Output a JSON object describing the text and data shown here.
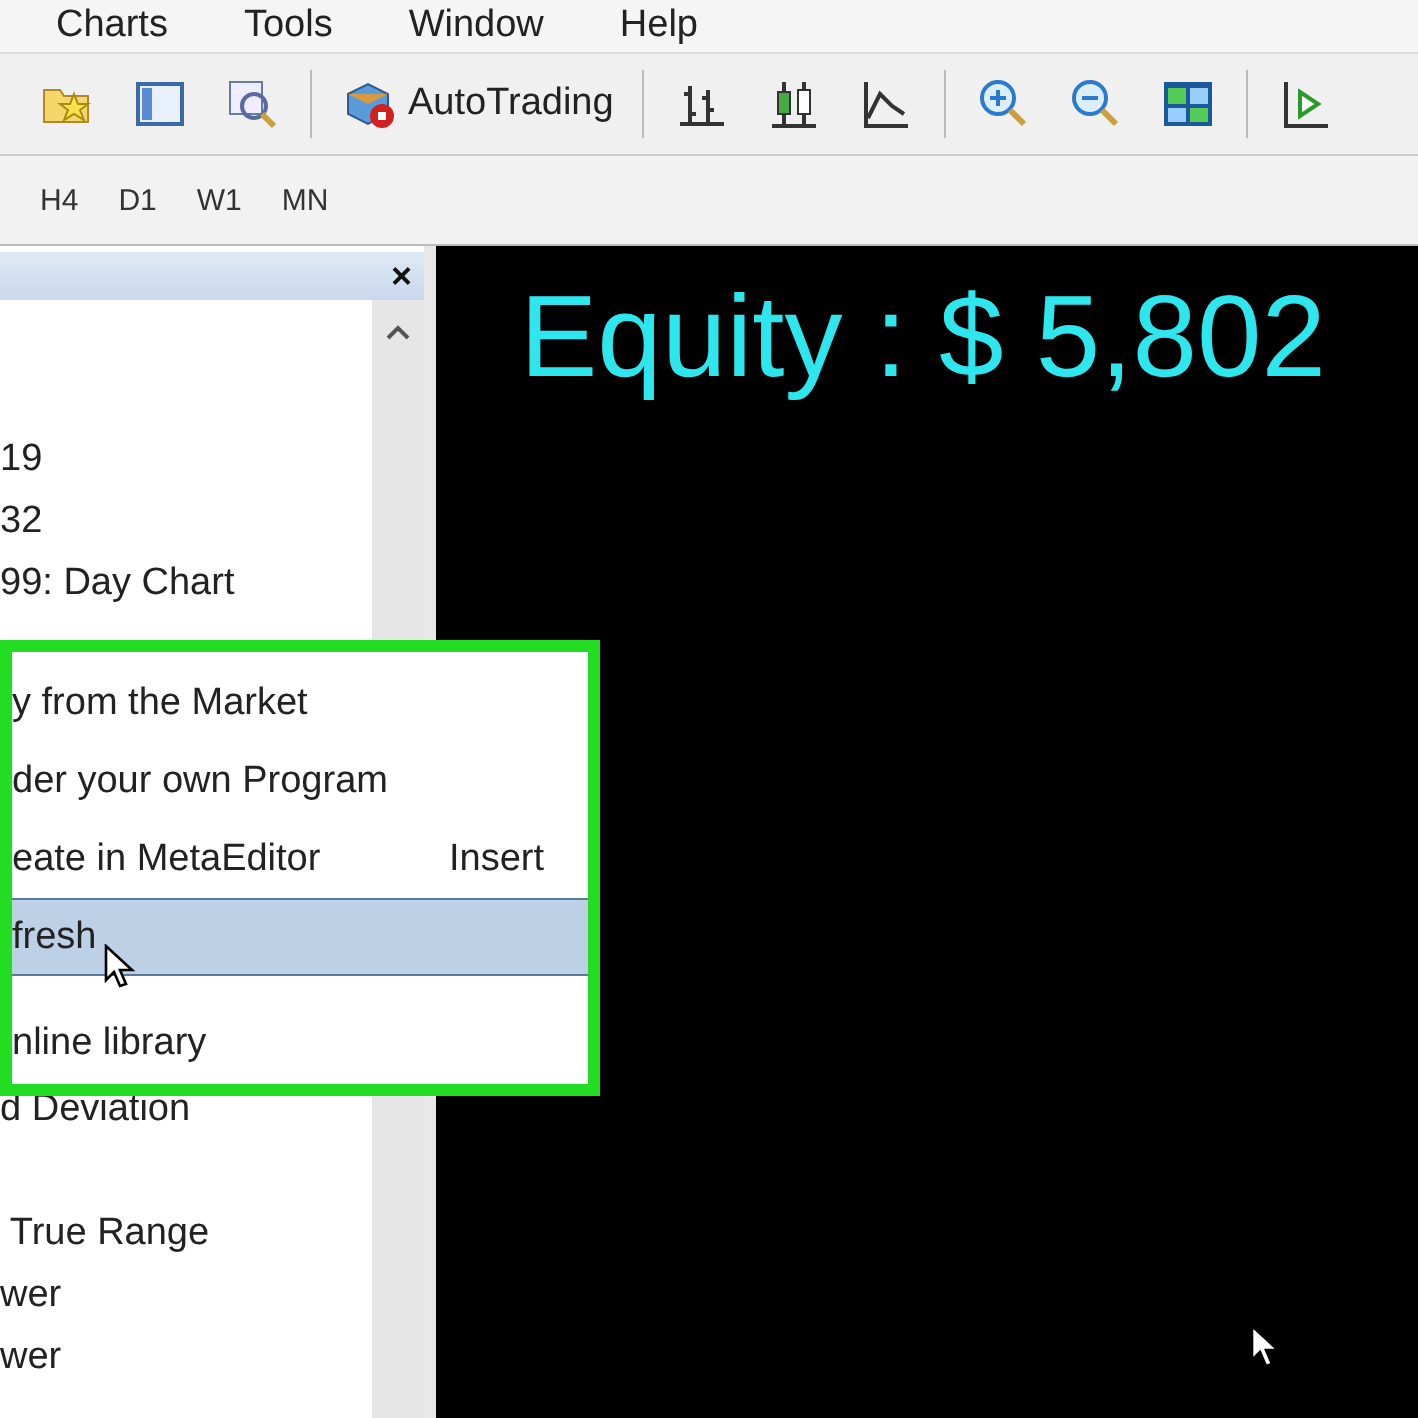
{
  "menu_bar": {
    "items": [
      "Charts",
      "Tools",
      "Window",
      "Help"
    ]
  },
  "toolbar": {
    "items": [
      {
        "kind": "starfolder"
      },
      {
        "kind": "panel"
      },
      {
        "kind": "magnifier"
      },
      {
        "kind": "autotrading",
        "label": "AutoTrading"
      },
      {
        "kind": "bars"
      },
      {
        "kind": "candles"
      },
      {
        "kind": "line"
      },
      {
        "kind": "zoomin"
      },
      {
        "kind": "zoomout"
      },
      {
        "kind": "tile"
      },
      {
        "kind": "shift"
      }
    ]
  },
  "timeframes": [
    "H4",
    "D1",
    "W1",
    "MN"
  ],
  "navigator": {
    "close": "×",
    "items": [
      "19",
      "32",
      "99: Day Chart"
    ],
    "items_below": [
      "d Deviation",
      " True Range",
      "wer",
      "wer"
    ]
  },
  "context_menu": {
    "items": [
      {
        "label": "y from the Market",
        "selected": false
      },
      {
        "label": "der your own Program",
        "selected": false
      },
      {
        "label": "eate in MetaEditor",
        "shortcut": "Insert",
        "selected": false
      },
      {
        "label": "fresh",
        "selected": true
      },
      {
        "label": "nline library",
        "selected": false
      }
    ]
  },
  "chart": {
    "equity_label": "Equity : $ 5,802"
  }
}
